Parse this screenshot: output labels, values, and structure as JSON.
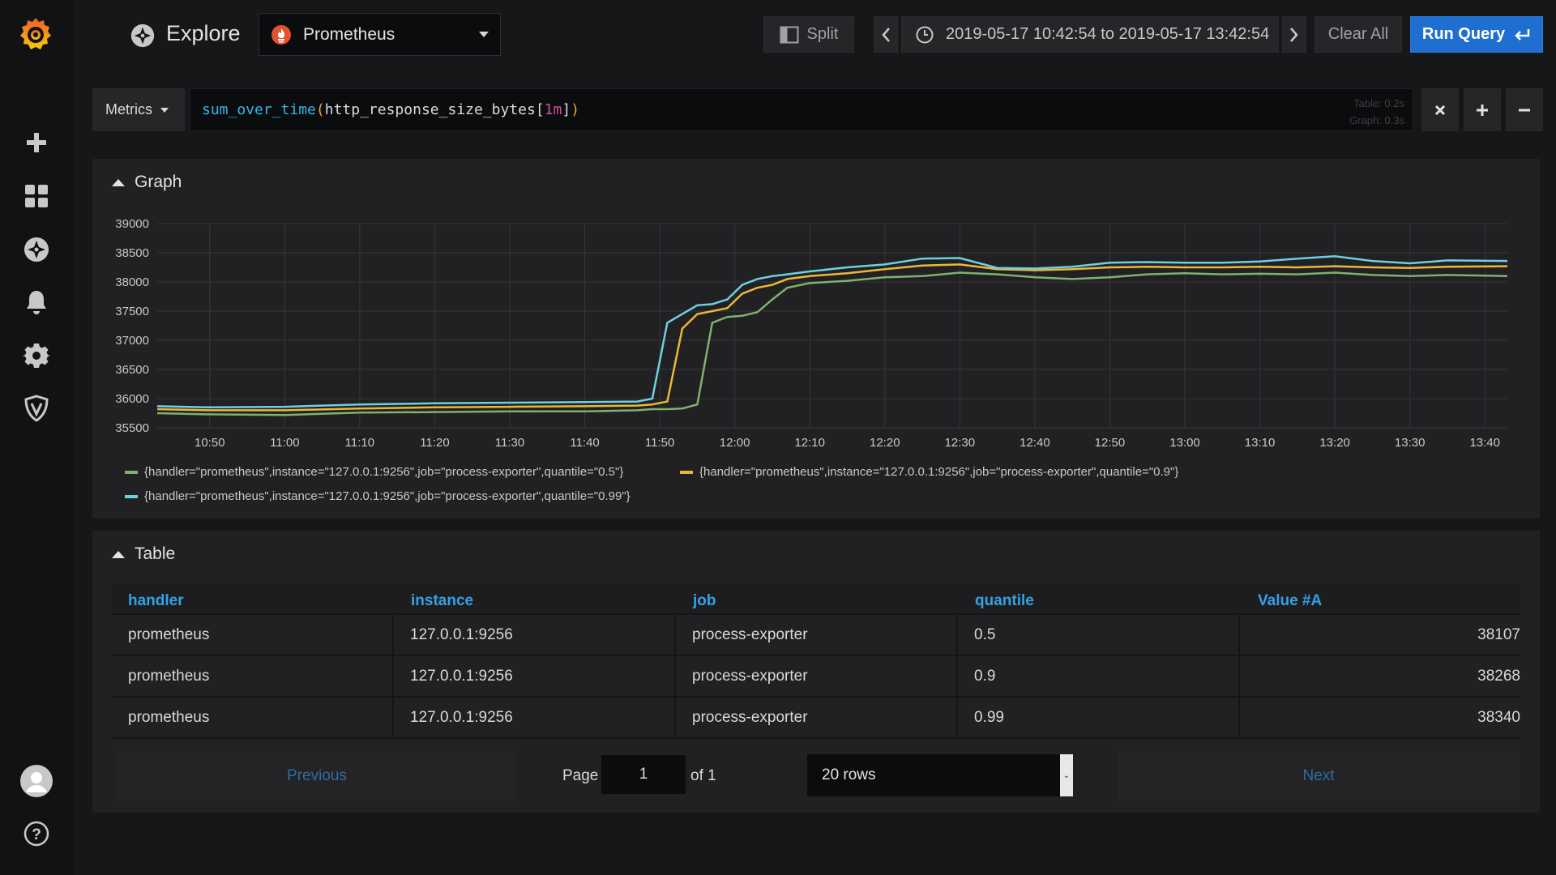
{
  "colors": {
    "accent": "#1f6fd0",
    "series_green": "#7eb26d",
    "series_yellow": "#eab839",
    "series_cyan": "#6ed0e0",
    "table_header": "#33a2e5"
  },
  "sidebar": {
    "items": [
      {
        "name": "create",
        "icon": "plus-icon"
      },
      {
        "name": "dashboards",
        "icon": "dashboards-icon"
      },
      {
        "name": "explore",
        "icon": "compass-icon"
      },
      {
        "name": "alerting",
        "icon": "bell-icon"
      },
      {
        "name": "configuration",
        "icon": "gear-icon"
      },
      {
        "name": "server-admin",
        "icon": "shield-icon"
      },
      {
        "name": "profile",
        "icon": "avatar-icon"
      },
      {
        "name": "help",
        "icon": "help-icon"
      }
    ]
  },
  "header": {
    "title": "Explore",
    "datasource": "Prometheus",
    "split_label": "Split",
    "time_range": "2019-05-17 10:42:54 to 2019-05-17 13:42:54",
    "clear_label": "Clear All",
    "run_label": "Run Query"
  },
  "query": {
    "mode_label": "Metrics",
    "fn": "sum_over_time",
    "open_paren": "(",
    "metric": "http_response_size_bytes",
    "open_bracket": "[",
    "duration": "1m",
    "close_bracket": "]",
    "close_paren": ")",
    "stats_table": "Table: 0.2s",
    "stats_graph": "Graph: 0.3s"
  },
  "graph": {
    "title": "Graph"
  },
  "chart_data": {
    "type": "line",
    "title": "",
    "xlabel": "",
    "ylabel": "",
    "x_ticks": [
      "10:50",
      "11:00",
      "11:10",
      "11:20",
      "11:30",
      "11:40",
      "11:50",
      "12:00",
      "12:10",
      "12:20",
      "12:30",
      "12:40",
      "12:50",
      "13:00",
      "13:10",
      "13:20",
      "13:30",
      "13:40"
    ],
    "y_ticks": [
      35500,
      36000,
      36500,
      37000,
      37500,
      38000,
      38500,
      39000
    ],
    "ylim": [
      35500,
      39000
    ],
    "xlim": [
      "10:43",
      "13:43"
    ],
    "grid": true,
    "legend_position": "bottom",
    "x": [
      "10:43",
      "10:50",
      "11:00",
      "11:10",
      "11:20",
      "11:30",
      "11:40",
      "11:47",
      "11:49",
      "11:51",
      "11:53",
      "11:55",
      "11:57",
      "11:59",
      "12:01",
      "12:03",
      "12:05",
      "12:07",
      "12:10",
      "12:15",
      "12:20",
      "12:25",
      "12:30",
      "12:35",
      "12:40",
      "12:45",
      "12:50",
      "12:55",
      "13:00",
      "13:05",
      "13:10",
      "13:15",
      "13:20",
      "13:25",
      "13:30",
      "13:35",
      "13:43"
    ],
    "series": [
      {
        "name": "{handler=\"prometheus\",instance=\"127.0.0.1:9256\",job=\"process-exporter\",quantile=\"0.5\"}",
        "color": "#7eb26d",
        "values": [
          35750,
          35730,
          35720,
          35760,
          35770,
          35780,
          35780,
          35800,
          35820,
          35820,
          35830,
          35900,
          37300,
          37400,
          37420,
          37480,
          37700,
          37900,
          37980,
          38020,
          38080,
          38100,
          38160,
          38130,
          38080,
          38050,
          38080,
          38130,
          38150,
          38130,
          38140,
          38130,
          38160,
          38120,
          38100,
          38120,
          38100
        ]
      },
      {
        "name": "{handler=\"prometheus\",instance=\"127.0.0.1:9256\",job=\"process-exporter\",quantile=\"0.9\"}",
        "color": "#eab839",
        "values": [
          35820,
          35800,
          35800,
          35830,
          35850,
          35860,
          35870,
          35880,
          35900,
          35950,
          37200,
          37450,
          37500,
          37550,
          37800,
          37900,
          37950,
          38050,
          38100,
          38150,
          38220,
          38280,
          38300,
          38220,
          38200,
          38220,
          38250,
          38260,
          38250,
          38250,
          38260,
          38250,
          38270,
          38250,
          38240,
          38260,
          38270
        ]
      },
      {
        "name": "{handler=\"prometheus\",instance=\"127.0.0.1:9256\",job=\"process-exporter\",quantile=\"0.99\"}",
        "color": "#6ed0e0",
        "values": [
          35870,
          35850,
          35860,
          35900,
          35920,
          35930,
          35940,
          35950,
          36000,
          37300,
          37450,
          37600,
          37620,
          37700,
          37950,
          38050,
          38100,
          38130,
          38180,
          38250,
          38300,
          38400,
          38410,
          38240,
          38230,
          38260,
          38330,
          38340,
          38330,
          38330,
          38350,
          38400,
          38440,
          38360,
          38320,
          38370,
          38360
        ]
      }
    ]
  },
  "table": {
    "title": "Table",
    "columns": [
      "handler",
      "instance",
      "job",
      "quantile",
      "Value #A"
    ],
    "rows": [
      [
        "prometheus",
        "127.0.0.1:9256",
        "process-exporter",
        "0.5",
        "38107"
      ],
      [
        "prometheus",
        "127.0.0.1:9256",
        "process-exporter",
        "0.9",
        "38268"
      ],
      [
        "prometheus",
        "127.0.0.1:9256",
        "process-exporter",
        "0.99",
        "38340"
      ]
    ],
    "pagination": {
      "previous": "Previous",
      "page_label": "Page",
      "page_value": "1",
      "of_label": "of 1",
      "rows_select": "20 rows",
      "next": "Next"
    }
  }
}
